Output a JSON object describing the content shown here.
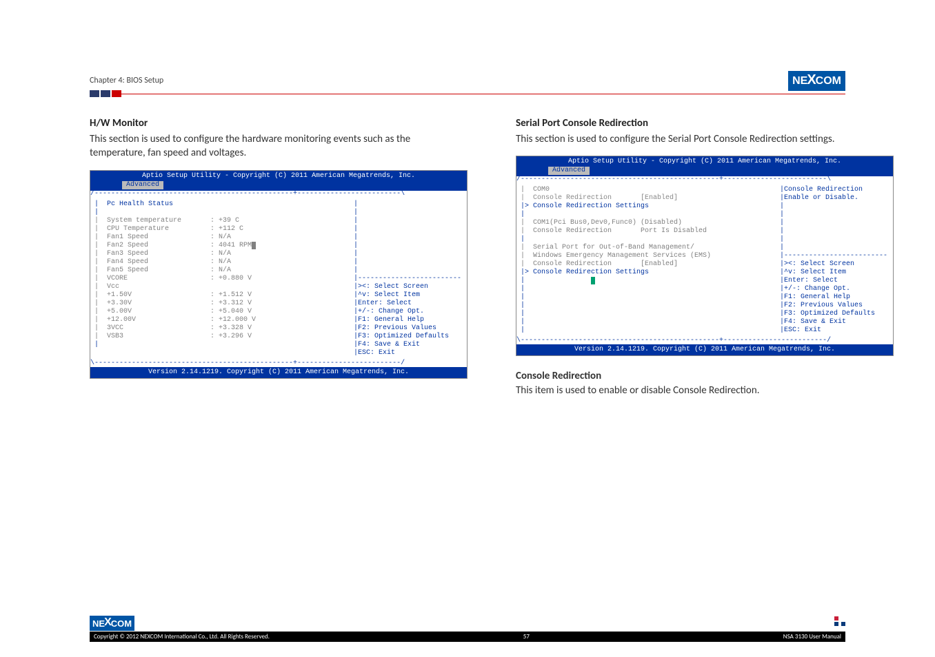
{
  "header": {
    "chapter": "Chapter 4: BIOS Setup"
  },
  "left": {
    "title": "H/W Monitor",
    "desc": "This section is used to configure the hardware monitoring events such as the temperature, fan speed and voltages.",
    "bios": {
      "topline": "Aptio Setup Utility - Copyright (C) 2011 American Megatrends, Inc.",
      "tab": "Advanced",
      "header_left": "Pc Health Status",
      "rows": [
        {
          "label": "System temperature",
          "val": ": +39 C",
          "gray": true
        },
        {
          "label": "CPU Temperature",
          "val": ": +112 C",
          "gray": true
        },
        {
          "label": "Fan1 Speed",
          "val": ": N/A",
          "gray": true
        },
        {
          "label": "Fan2 Speed",
          "val": ": 4041 RPM",
          "gray": true,
          "cursor": true
        },
        {
          "label": "Fan3 Speed",
          "val": ": N/A",
          "gray": true
        },
        {
          "label": "Fan4 Speed",
          "val": ": N/A",
          "gray": true
        },
        {
          "label": "Fan5 Speed",
          "val": ": N/A",
          "gray": true
        },
        {
          "label": "VCORE",
          "val": ": +0.880 V",
          "gray": true
        },
        {
          "label": "Vcc",
          "val": "",
          "gray": true
        },
        {
          "label": "+1.50V",
          "val": ": +1.512 V",
          "gray": true
        },
        {
          "label": "+3.30V",
          "val": ": +3.312 V",
          "gray": true
        },
        {
          "label": "+5.00V",
          "val": ": +5.040 V",
          "gray": true
        },
        {
          "label": "+12.00V",
          "val": ": +12.000 V",
          "gray": true
        },
        {
          "label": "3VCC",
          "val": ": +3.328 V",
          "gray": true
        },
        {
          "label": "VSB3",
          "val": ": +3.296 V",
          "gray": true
        }
      ],
      "help_top": "",
      "help": [
        "><: Select Screen",
        "^v: Select Item",
        "Enter: Select",
        "+/-: Change Opt.",
        "F1: General Help",
        "F2: Previous Values",
        "F3: Optimized Defaults",
        "F4: Save & Exit",
        "ESC: Exit"
      ],
      "footer": "Version 2.14.1219. Copyright (C) 2011 American Megatrends, Inc."
    }
  },
  "right": {
    "title": "Serial Port Console Redirection",
    "desc": "This section is used to configure the Serial Port Console Redirection settings.",
    "bios": {
      "topline": "Aptio Setup Utility - Copyright (C) 2011 American Megatrends, Inc.",
      "tab": "Advanced",
      "rows_top": [
        {
          "text": "COM0",
          "gray": true
        },
        {
          "text": "Console Redirection       [Enabled]",
          "gray": false,
          "white": true
        },
        {
          "text": "> Console Redirection Settings",
          "gray": false
        },
        {
          "text": "",
          "gray": true
        },
        {
          "text": "COM1(Pci Bus0,Dev0,Func0) (Disabled)",
          "gray": true
        },
        {
          "text": "Console Redirection       Port Is Disabled",
          "gray": true
        },
        {
          "text": "",
          "gray": true
        },
        {
          "text": "Serial Port for Out-of-Band Management/",
          "gray": true
        },
        {
          "text": "Windows Emergency Management Services (EMS)",
          "gray": true
        },
        {
          "text": "Console Redirection       [Enabled]",
          "gray": true
        },
        {
          "text": "> Console Redirection Settings",
          "gray": false
        }
      ],
      "help_top": [
        "Console Redirection",
        "Enable or Disable."
      ],
      "help": [
        "><: Select Screen",
        "^v: Select Item",
        "Enter: Select",
        "+/-: Change Opt.",
        "F1: General Help",
        "F2: Previous Values",
        "F3: Optimized Defaults",
        "F4: Save & Exit",
        "ESC: Exit"
      ],
      "footer": "Version 2.14.1219. Copyright (C) 2011 American Megatrends, Inc."
    },
    "sub_title": "Console Redirection",
    "sub_desc": "This item is used to enable or disable Console Redirection."
  },
  "footer": {
    "copyright": "Copyright © 2012 NEXCOM International Co., Ltd. All Rights Reserved.",
    "page": "57",
    "manual": "NSA 3130 User Manual"
  },
  "logo_text": {
    "pre": "NE",
    "x": "X",
    "post": "COM"
  }
}
